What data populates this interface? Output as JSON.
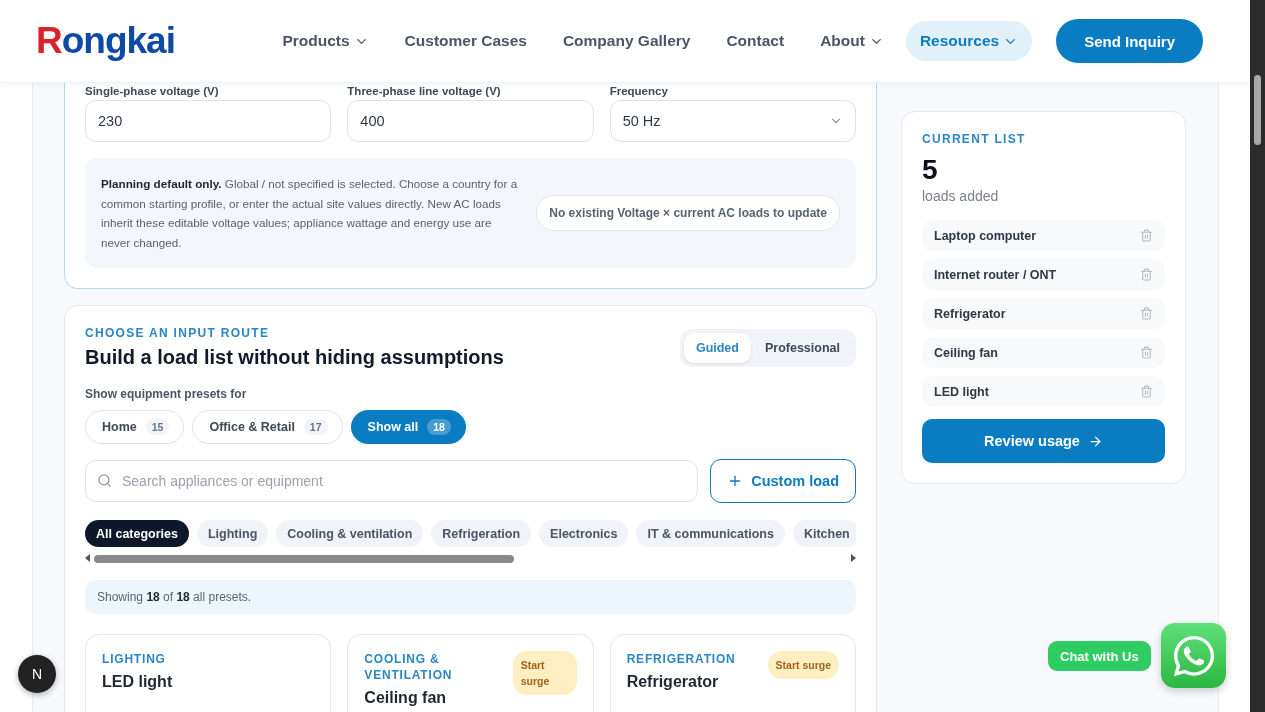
{
  "header": {
    "logo": "Rongkai",
    "nav": [
      {
        "label": "Products",
        "has_menu": true,
        "selected": false
      },
      {
        "label": "Customer Cases",
        "has_menu": false,
        "selected": false
      },
      {
        "label": "Company Gallery",
        "has_menu": false,
        "selected": false
      },
      {
        "label": "Contact",
        "has_menu": false,
        "selected": false
      },
      {
        "label": "About",
        "has_menu": true,
        "selected": false
      },
      {
        "label": "Resources",
        "has_menu": true,
        "selected": true
      }
    ],
    "cta": "Send Inquiry"
  },
  "power": {
    "fields": [
      {
        "label": "Single-phase voltage (V)",
        "value": "230",
        "kind": "text"
      },
      {
        "label": "Three-phase line voltage (V)",
        "value": "400",
        "kind": "text"
      },
      {
        "label": "Frequency",
        "value": "50 Hz",
        "kind": "select"
      }
    ],
    "note": "**Planning default only.** Global / not specified is selected. Choose a country for a common starting profile, or enter the actual site values directly. New AC loads inherit these editable voltage values; appliance wattage and energy use are never changed.",
    "update_pill": "No existing Voltage × current AC loads to update"
  },
  "route": {
    "eyebrow": "CHOOSE AN INPUT ROUTE",
    "title": "Build a load list without hiding assumptions",
    "modes": [
      {
        "label": "Guided",
        "selected": true
      },
      {
        "label": "Professional",
        "selected": false
      }
    ],
    "presets_label": "Show equipment presets for",
    "segments": [
      {
        "label": "Home",
        "count": "15",
        "selected": false
      },
      {
        "label": "Office & Retail",
        "count": "17",
        "selected": false
      },
      {
        "label": "Show all",
        "count": "18",
        "selected": true
      }
    ],
    "search": {
      "placeholder": "Search appliances or equipment"
    },
    "custom_button": "Custom load",
    "categories": [
      {
        "label": "All categories",
        "selected": true
      },
      {
        "label": "Lighting",
        "selected": false
      },
      {
        "label": "Cooling & ventilation",
        "selected": false
      },
      {
        "label": "Refrigeration",
        "selected": false
      },
      {
        "label": "Electronics",
        "selected": false
      },
      {
        "label": "IT & communications",
        "selected": false
      },
      {
        "label": "Kitchen",
        "selected": false
      }
    ],
    "status": "Showing **18** of **18** all presets.",
    "cards": [
      {
        "category": "LIGHTING",
        "name": "LED light"
      },
      {
        "category": "COOLING & VENTILATION",
        "name": "Ceiling fan",
        "badge": "Start surge"
      },
      {
        "category": "REFRIGERATION",
        "name": "Refrigerator",
        "badge": "Start surge"
      }
    ]
  },
  "current_list": {
    "eyebrow": "CURRENT LIST",
    "count": "5",
    "caption": "loads added",
    "items": [
      "Laptop computer",
      "Internet router / ONT",
      "Refrigerator",
      "Ceiling fan",
      "LED light"
    ],
    "action": "Review usage"
  },
  "chat": {
    "label": "Chat with Us"
  },
  "dev_badge": "N"
}
